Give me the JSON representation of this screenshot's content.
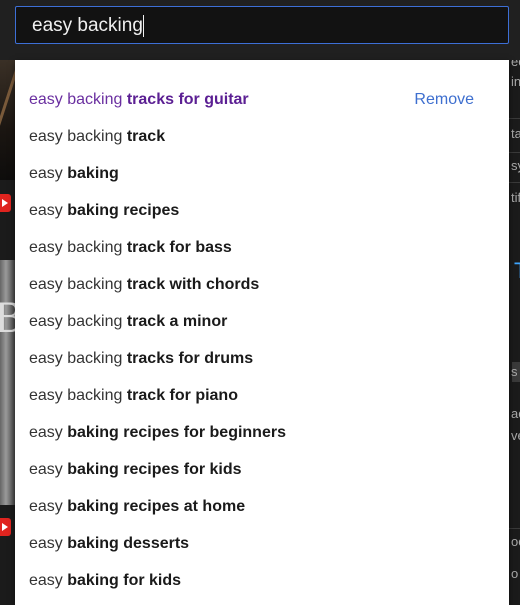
{
  "search": {
    "query": "easy backing"
  },
  "suggestions": [
    {
      "typed": "easy backing ",
      "rest": "tracks for guitar",
      "visited": true,
      "action": "Remove"
    },
    {
      "typed": "easy backing ",
      "rest": "track"
    },
    {
      "typed": "easy ",
      "rest": "baking"
    },
    {
      "typed": "easy ",
      "rest": "baking recipes"
    },
    {
      "typed": "easy backing ",
      "rest": "track for bass"
    },
    {
      "typed": "easy backing ",
      "rest": "track with chords"
    },
    {
      "typed": "easy backing ",
      "rest": "track a minor"
    },
    {
      "typed": "easy backing ",
      "rest": "tracks for drums"
    },
    {
      "typed": "easy backing ",
      "rest": "track for piano"
    },
    {
      "typed": "easy ",
      "rest": "baking recipes for beginners"
    },
    {
      "typed": "easy ",
      "rest": "baking recipes for kids"
    },
    {
      "typed": "easy ",
      "rest": "baking recipes at home"
    },
    {
      "typed": "easy ",
      "rest": "baking desserts"
    },
    {
      "typed": "easy ",
      "rest": "baking for kids"
    }
  ],
  "background": {
    "thumb_letter": "B",
    "right_edge_fragments": [
      "ec",
      "in",
      "ta",
      "sy",
      "tif",
      "T",
      "s",
      "ac",
      "ve",
      "oc",
      "o"
    ]
  },
  "colors": {
    "accent": "#3e6fcf",
    "visited": "#5b1f93",
    "focus_border": "#3d6fd6"
  }
}
